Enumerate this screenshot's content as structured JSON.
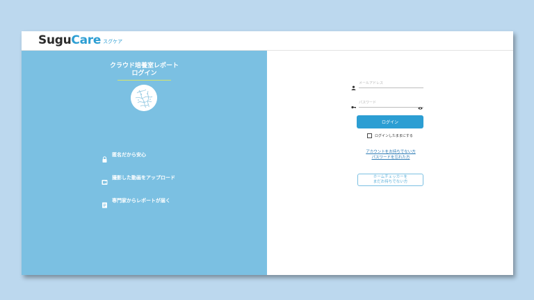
{
  "brand": {
    "logo_sugu": "Sugu",
    "logo_care": "Care",
    "logo_kana": "スグケア"
  },
  "left": {
    "title_line1": "クラウド培養室レポート",
    "title_line2": "ログイン",
    "features": [
      {
        "label": "匿名だから安心",
        "icon": "lock-icon"
      },
      {
        "label": "撮影した動画をアップロード",
        "icon": "video-icon"
      },
      {
        "label": "専門家からレポートが届く",
        "icon": "document-icon"
      }
    ],
    "colors": {
      "panel": "#7bc0e2",
      "accent": "#d8e46a"
    }
  },
  "form": {
    "email_placeholder": "メールアドレス",
    "password_placeholder": "パスワード",
    "login_button": "ログイン",
    "remember_label": "ログインしたままにする",
    "no_account_link": "アカウントをお持ちでない方",
    "forgot_password_link": "パスワードを忘れた方",
    "home_checker_line1": "ホームチェッカーを",
    "home_checker_line2": "まだお持ちでない方",
    "colors": {
      "primary": "#2c9ed3",
      "link": "#2c7bb5"
    }
  }
}
